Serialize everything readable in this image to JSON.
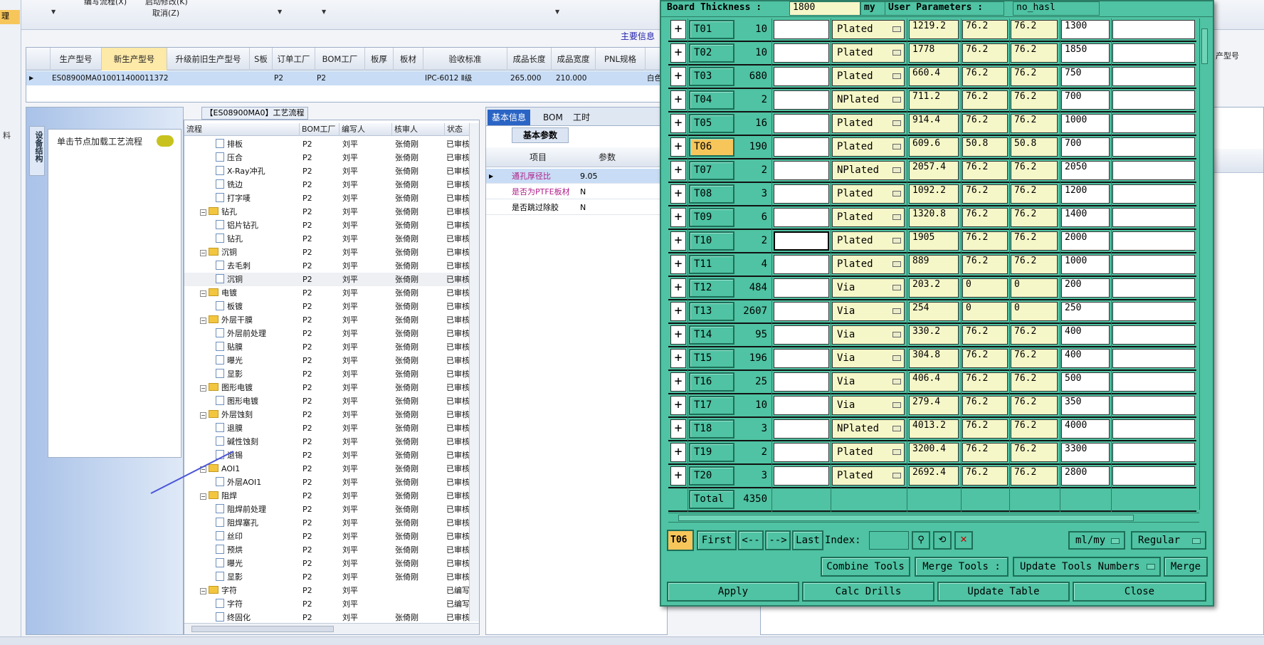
{
  "toolbar": {
    "label1": "编写流程(X)",
    "label2": "启动修改(K)",
    "label3": "取消(Z)"
  },
  "left_strip_text1": "理",
  "left_strip_text2": "料",
  "main_info_tab": "主要信息",
  "product_grid": {
    "headers": [
      "生产型号",
      "新生产型号",
      "升级前旧生产型号",
      "S板",
      "订单工厂",
      "BOM工厂",
      "板厚",
      "板材",
      "验收标准",
      "成品长度",
      "成品宽度",
      "PNL规格"
    ],
    "row": {
      "model": "ES08900MA0",
      "new_model": "10011400011372",
      "order_factory": "P2",
      "bom_factory": "P2",
      "standard": "IPC-6012 Ⅱ级",
      "length": "265.000",
      "width": "210.000",
      "extra": "白色"
    }
  },
  "left_panel": {
    "vertical_tab": "设备结构",
    "hint": "单击节点加载工艺流程"
  },
  "tree": {
    "title": "【ES08900MA0】工艺流程",
    "headers": [
      "流程",
      "BOM工厂",
      "编写人",
      "核审人",
      "状态"
    ],
    "rows": [
      {
        "level": 2,
        "type": "file",
        "name": "排板",
        "bom": "P2",
        "writer": "刘平",
        "reviewer": "张倚刚",
        "status": "已审核"
      },
      {
        "level": 2,
        "type": "file",
        "name": "压合",
        "bom": "P2",
        "writer": "刘平",
        "reviewer": "张倚刚",
        "status": "已审核"
      },
      {
        "level": 2,
        "type": "file",
        "name": "X-Ray冲孔",
        "bom": "P2",
        "writer": "刘平",
        "reviewer": "张倚刚",
        "status": "已审核"
      },
      {
        "level": 2,
        "type": "file",
        "name": "铣边",
        "bom": "P2",
        "writer": "刘平",
        "reviewer": "张倚刚",
        "status": "已审核"
      },
      {
        "level": 2,
        "type": "file",
        "name": "打字唛",
        "bom": "P2",
        "writer": "刘平",
        "reviewer": "张倚刚",
        "status": "已审核"
      },
      {
        "level": 1,
        "type": "folder",
        "name": "钻孔",
        "bom": "P2",
        "writer": "刘平",
        "reviewer": "张倚刚",
        "status": "已审核"
      },
      {
        "level": 2,
        "type": "file",
        "name": "铝片钻孔",
        "bom": "P2",
        "writer": "刘平",
        "reviewer": "张倚刚",
        "status": "已审核"
      },
      {
        "level": 2,
        "type": "file",
        "name": "钻孔",
        "bom": "P2",
        "writer": "刘平",
        "reviewer": "张倚刚",
        "status": "已审核"
      },
      {
        "level": 1,
        "type": "folder",
        "name": "沉铜",
        "bom": "P2",
        "writer": "刘平",
        "reviewer": "张倚刚",
        "status": "已审核"
      },
      {
        "level": 2,
        "type": "file",
        "name": "去毛刺",
        "bom": "P2",
        "writer": "刘平",
        "reviewer": "张倚刚",
        "status": "已审核"
      },
      {
        "level": 2,
        "type": "file",
        "name": "沉铜",
        "bom": "P2",
        "writer": "刘平",
        "reviewer": "张倚刚",
        "status": "已审核",
        "selected": true
      },
      {
        "level": 1,
        "type": "folder",
        "name": "电镀",
        "bom": "P2",
        "writer": "刘平",
        "reviewer": "张倚刚",
        "status": "已审核"
      },
      {
        "level": 2,
        "type": "file",
        "name": "板镀",
        "bom": "P2",
        "writer": "刘平",
        "reviewer": "张倚刚",
        "status": "已审核"
      },
      {
        "level": 1,
        "type": "folder",
        "name": "外层干膜",
        "bom": "P2",
        "writer": "刘平",
        "reviewer": "张倚刚",
        "status": "已审核"
      },
      {
        "level": 2,
        "type": "file",
        "name": "外层前处理",
        "bom": "P2",
        "writer": "刘平",
        "reviewer": "张倚刚",
        "status": "已审核"
      },
      {
        "level": 2,
        "type": "file",
        "name": "贴膜",
        "bom": "P2",
        "writer": "刘平",
        "reviewer": "张倚刚",
        "status": "已审核"
      },
      {
        "level": 2,
        "type": "file",
        "name": "曝光",
        "bom": "P2",
        "writer": "刘平",
        "reviewer": "张倚刚",
        "status": "已审核"
      },
      {
        "level": 2,
        "type": "file",
        "name": "显影",
        "bom": "P2",
        "writer": "刘平",
        "reviewer": "张倚刚",
        "status": "已审核"
      },
      {
        "level": 1,
        "type": "folder",
        "name": "图形电镀",
        "bom": "P2",
        "writer": "刘平",
        "reviewer": "张倚刚",
        "status": "已审核"
      },
      {
        "level": 2,
        "type": "file",
        "name": "图形电镀",
        "bom": "P2",
        "writer": "刘平",
        "reviewer": "张倚刚",
        "status": "已审核"
      },
      {
        "level": 1,
        "type": "folder",
        "name": "外层蚀刻",
        "bom": "P2",
        "writer": "刘平",
        "reviewer": "张倚刚",
        "status": "已审核"
      },
      {
        "level": 2,
        "type": "file",
        "name": "退膜",
        "bom": "P2",
        "writer": "刘平",
        "reviewer": "张倚刚",
        "status": "已审核"
      },
      {
        "level": 2,
        "type": "file",
        "name": "碱性蚀刻",
        "bom": "P2",
        "writer": "刘平",
        "reviewer": "张倚刚",
        "status": "已审核"
      },
      {
        "level": 2,
        "type": "file",
        "name": "退锡",
        "bom": "P2",
        "writer": "刘平",
        "reviewer": "张倚刚",
        "status": "已审核"
      },
      {
        "level": 1,
        "type": "folder",
        "name": "AOI1",
        "bom": "P2",
        "writer": "刘平",
        "reviewer": "张倚刚",
        "status": "已审核"
      },
      {
        "level": 2,
        "type": "file",
        "name": "外层AOI1",
        "bom": "P2",
        "writer": "刘平",
        "reviewer": "张倚刚",
        "status": "已审核"
      },
      {
        "level": 1,
        "type": "folder",
        "name": "阻焊",
        "bom": "P2",
        "writer": "刘平",
        "reviewer": "张倚刚",
        "status": "已审核"
      },
      {
        "level": 2,
        "type": "file",
        "name": "阻焊前处理",
        "bom": "P2",
        "writer": "刘平",
        "reviewer": "张倚刚",
        "status": "已审核"
      },
      {
        "level": 2,
        "type": "file",
        "name": "阻焊塞孔",
        "bom": "P2",
        "writer": "刘平",
        "reviewer": "张倚刚",
        "status": "已审核"
      },
      {
        "level": 2,
        "type": "file",
        "name": "丝印",
        "bom": "P2",
        "writer": "刘平",
        "reviewer": "张倚刚",
        "status": "已审核"
      },
      {
        "level": 2,
        "type": "file",
        "name": "预烘",
        "bom": "P2",
        "writer": "刘平",
        "reviewer": "张倚刚",
        "status": "已审核"
      },
      {
        "level": 2,
        "type": "file",
        "name": "曝光",
        "bom": "P2",
        "writer": "刘平",
        "reviewer": "张倚刚",
        "status": "已审核"
      },
      {
        "level": 2,
        "type": "file",
        "name": "显影",
        "bom": "P2",
        "writer": "刘平",
        "reviewer": "张倚刚",
        "status": "已审核"
      },
      {
        "level": 1,
        "type": "folder",
        "name": "字符",
        "bom": "P2",
        "writer": "刘平",
        "reviewer": "",
        "status": "已编写"
      },
      {
        "level": 2,
        "type": "file",
        "name": "字符",
        "bom": "P2",
        "writer": "刘平",
        "reviewer": "",
        "status": "已编写"
      },
      {
        "level": 2,
        "type": "file",
        "name": "终固化",
        "bom": "P2",
        "writer": "刘平",
        "reviewer": "张倚刚",
        "status": "已审核"
      }
    ]
  },
  "info_panel": {
    "tabs": [
      "基本信息",
      "BOM",
      "工时"
    ],
    "subtab": "基本参数",
    "headers": [
      "项目",
      "参数"
    ],
    "rows": [
      {
        "item": "通孔厚径比",
        "value": "9.05",
        "selected": true,
        "color": "#b0208a"
      },
      {
        "item": "是否为PTFE板材",
        "value": "N",
        "color": "#b0208a"
      },
      {
        "item": "是否跳过除胶",
        "value": "N",
        "color": "#000000"
      }
    ]
  },
  "far_right_label": "产型号",
  "dialog": {
    "board_thickness_label": "Board Thickness :",
    "board_thickness_value": "1800",
    "unit": "my",
    "user_params_label": "User Parameters :",
    "user_params_value": "no_hasl",
    "tools": [
      {
        "name": "T01",
        "count": "10",
        "type": "Plated",
        "v1": "1219.2",
        "v2": "76.2",
        "v3": "76.2",
        "v4": "1300"
      },
      {
        "name": "T02",
        "count": "10",
        "type": "Plated",
        "v1": "1778",
        "v2": "76.2",
        "v3": "76.2",
        "v4": "1850"
      },
      {
        "name": "T03",
        "count": "680",
        "type": "Plated",
        "v1": "660.4",
        "v2": "76.2",
        "v3": "76.2",
        "v4": "750"
      },
      {
        "name": "T04",
        "count": "2",
        "type": "NPlated",
        "v1": "711.2",
        "v2": "76.2",
        "v3": "76.2",
        "v4": "700"
      },
      {
        "name": "T05",
        "count": "16",
        "type": "Plated",
        "v1": "914.4",
        "v2": "76.2",
        "v3": "76.2",
        "v4": "1000"
      },
      {
        "name": "T06",
        "count": "190",
        "type": "Plated",
        "v1": "609.6",
        "v2": "50.8",
        "v3": "50.8",
        "v4": "700",
        "current": true
      },
      {
        "name": "T07",
        "count": "2",
        "type": "NPlated",
        "v1": "2057.4",
        "v2": "76.2",
        "v3": "76.2",
        "v4": "2050"
      },
      {
        "name": "T08",
        "count": "3",
        "type": "Plated",
        "v1": "1092.2",
        "v2": "76.2",
        "v3": "76.2",
        "v4": "1200"
      },
      {
        "name": "T09",
        "count": "6",
        "type": "Plated",
        "v1": "1320.8",
        "v2": "76.2",
        "v3": "76.2",
        "v4": "1400"
      },
      {
        "name": "T10",
        "count": "2",
        "type": "Plated",
        "v1": "1905",
        "v2": "76.2",
        "v3": "76.2",
        "v4": "2000",
        "focus": true
      },
      {
        "name": "T11",
        "count": "4",
        "type": "Plated",
        "v1": "889",
        "v2": "76.2",
        "v3": "76.2",
        "v4": "1000"
      },
      {
        "name": "T12",
        "count": "484",
        "type": "Via",
        "v1": "203.2",
        "v2": "0",
        "v3": "0",
        "v4": "200"
      },
      {
        "name": "T13",
        "count": "2607",
        "type": "Via",
        "v1": "254",
        "v2": "0",
        "v3": "0",
        "v4": "250"
      },
      {
        "name": "T14",
        "count": "95",
        "type": "Via",
        "v1": "330.2",
        "v2": "76.2",
        "v3": "76.2",
        "v4": "400"
      },
      {
        "name": "T15",
        "count": "196",
        "type": "Via",
        "v1": "304.8",
        "v2": "76.2",
        "v3": "76.2",
        "v4": "400"
      },
      {
        "name": "T16",
        "count": "25",
        "type": "Via",
        "v1": "406.4",
        "v2": "76.2",
        "v3": "76.2",
        "v4": "500"
      },
      {
        "name": "T17",
        "count": "10",
        "type": "Via",
        "v1": "279.4",
        "v2": "76.2",
        "v3": "76.2",
        "v4": "350"
      },
      {
        "name": "T18",
        "count": "3",
        "type": "NPlated",
        "v1": "4013.2",
        "v2": "76.2",
        "v3": "76.2",
        "v4": "4000"
      },
      {
        "name": "T19",
        "count": "2",
        "type": "Plated",
        "v1": "3200.4",
        "v2": "76.2",
        "v3": "76.2",
        "v4": "3300"
      },
      {
        "name": "T20",
        "count": "3",
        "type": "Plated",
        "v1": "2692.4",
        "v2": "76.2",
        "v3": "76.2",
        "v4": "2800"
      }
    ],
    "total_label": "Total",
    "total_count": "4350",
    "current_tool": "T06",
    "nav": {
      "first": "First",
      "prev": "<--",
      "next": "-->",
      "last": "Last",
      "index_label": "Index:",
      "units": "ml/my",
      "mode": "Regular"
    },
    "combine_tools": "Combine Tools",
    "merge_tools_label": "Merge Tools :",
    "update_tools_numbers": "Update Tools Numbers",
    "merge": "Merge",
    "apply": "Apply",
    "calc_drills": "Calc Drills",
    "update_table": "Update Table",
    "close": "Close"
  }
}
